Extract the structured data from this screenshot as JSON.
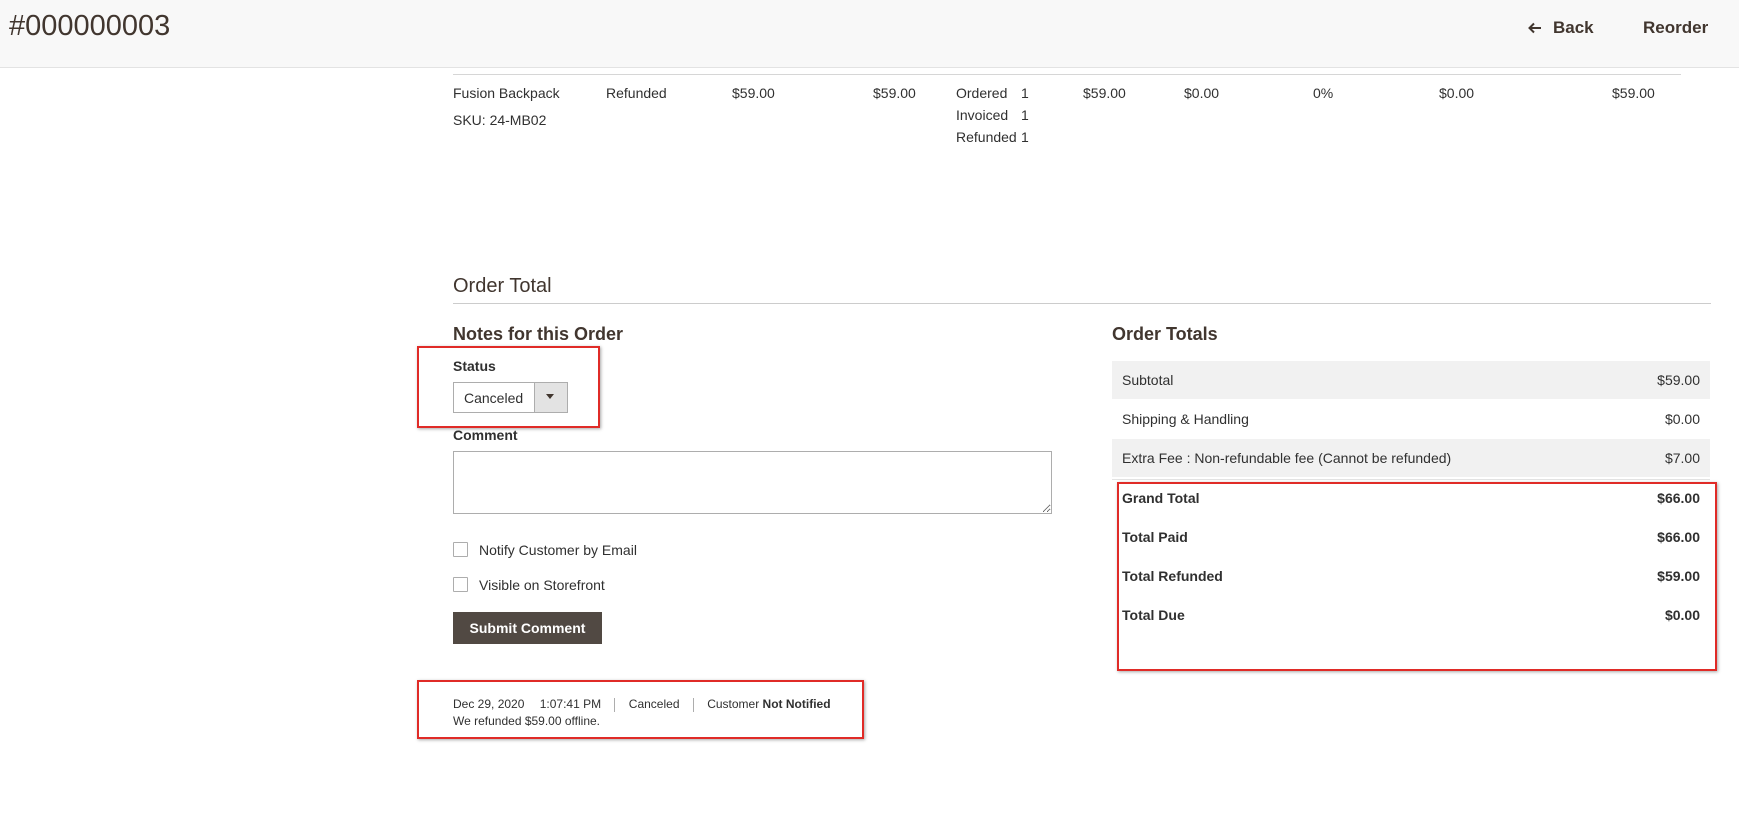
{
  "header": {
    "title": "#000000003",
    "back_label": "Back",
    "reorder_label": "Reorder"
  },
  "item": {
    "name": "Fusion Backpack",
    "sku": "SKU: 24-MB02",
    "status": "Refunded",
    "original_price": "$59.00",
    "price": "$59.00",
    "qty_ordered_label": "Ordered",
    "qty_ordered": "1",
    "qty_invoiced_label": "Invoiced",
    "qty_invoiced": "1",
    "qty_refunded_label": "Refunded",
    "qty_refunded": "1",
    "subtotal": "$59.00",
    "tax_amount": "$0.00",
    "tax_percent": "0%",
    "discount": "$0.00",
    "row_total": "$59.00"
  },
  "order_total": {
    "section_title": "Order Total",
    "notes": {
      "title": "Notes for this Order",
      "status_label": "Status",
      "status_value": "Canceled",
      "comment_label": "Comment",
      "comment_value": "",
      "notify_label": "Notify Customer by Email",
      "visible_label": "Visible on Storefront",
      "submit_label": "Submit Comment"
    },
    "history": {
      "date": "Dec 29, 2020",
      "time": "1:07:41 PM",
      "status": "Canceled",
      "customer_label": "Customer",
      "customer_state": "Not Notified",
      "comment": "We refunded $59.00 offline."
    },
    "totals": {
      "title": "Order Totals",
      "rows": [
        {
          "label": "Subtotal",
          "value": "$59.00"
        },
        {
          "label": "Shipping & Handling",
          "value": "$0.00"
        },
        {
          "label": "Extra Fee : Non-refundable fee (Cannot be refunded)",
          "value": "$7.00"
        }
      ],
      "grand_rows": [
        {
          "label": "Grand Total",
          "value": "$66.00"
        },
        {
          "label": "Total Paid",
          "value": "$66.00"
        },
        {
          "label": "Total Refunded",
          "value": "$59.00"
        },
        {
          "label": "Total Due",
          "value": "$0.00"
        }
      ]
    }
  },
  "colors": {
    "annotation": "#e02b27",
    "button_dark": "#514943",
    "heading": "#41362f",
    "row_shade": "#f1f1f1"
  },
  "icons": {
    "back": "arrow-left-icon",
    "select": "chevron-down-icon"
  }
}
